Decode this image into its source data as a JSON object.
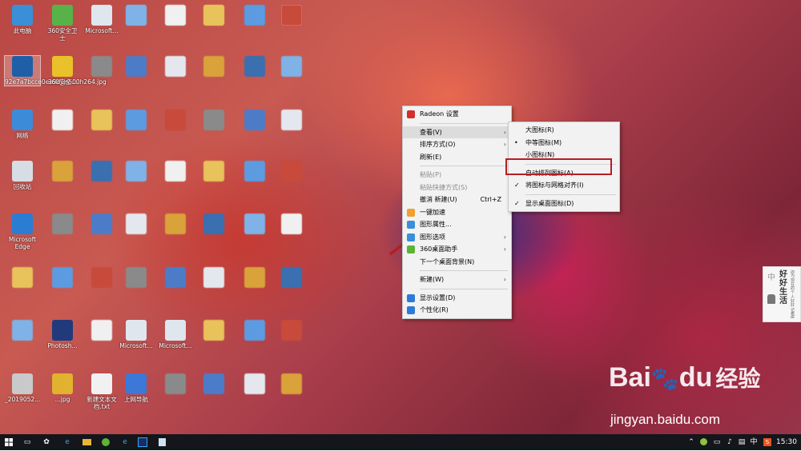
{
  "desktop_icons": [
    {
      "label": "此电脑",
      "color": "#3b8fd6"
    },
    {
      "label": "360安全卫士",
      "color": "#58b24a"
    },
    {
      "label": "Microsoft...",
      "color": "#dfe6ee"
    },
    {
      "label": "",
      "color": "#7a9abb"
    },
    {
      "label": "",
      "color": "#5a8fd8"
    },
    {
      "label": "",
      "color": "#e0a23c"
    },
    {
      "label": "",
      "color": "#6a6a6a"
    },
    {
      "label": "",
      "color": "#e7ecf4"
    },
    {
      "label": "92e7a7bcce0ee9d_w500h264.jpg",
      "color": "#1e5fa8"
    },
    {
      "label": "360安全...",
      "color": "#e9c12a"
    },
    {
      "label": "网络",
      "color": "#3c8bd9"
    },
    {
      "label": "回收站",
      "color": "#d7dde4"
    },
    {
      "label": "Microsoft Edge",
      "color": "#2b7cd3"
    },
    {
      "label": "Photosh...",
      "color": "#203a7c"
    },
    {
      "label": "Microsoft...",
      "color": "#dfe6ee"
    },
    {
      "label": "Microsoft...",
      "color": "#dfe6ee"
    },
    {
      "label": "新建文本文档.txt",
      "color": "#f1f1f1"
    },
    {
      "label": "上网导航",
      "color": "#3c78d8"
    },
    {
      "label": "_2019052...",
      "color": "#c9c9c9"
    },
    {
      "label": "...jpg",
      "color": "#e0b230"
    }
  ],
  "context_menu": {
    "items": [
      {
        "type": "item",
        "label": "Radeon 设置",
        "icon": "radeon-icon",
        "icon_color": "#d32f2f"
      },
      {
        "type": "sep"
      },
      {
        "type": "item",
        "label": "查看(V)",
        "submenu": true,
        "highlighted": true
      },
      {
        "type": "item",
        "label": "排序方式(O)",
        "submenu": true
      },
      {
        "type": "item",
        "label": "刷新(E)"
      },
      {
        "type": "sep"
      },
      {
        "type": "item",
        "label": "粘贴(P)",
        "disabled": true
      },
      {
        "type": "item",
        "label": "粘贴快捷方式(S)",
        "disabled": true
      },
      {
        "type": "item",
        "label": "撤消 新建(U)",
        "shortcut": "Ctrl+Z"
      },
      {
        "type": "item",
        "label": "一键加速",
        "icon": "speedup-icon",
        "icon_color": "#f0a030"
      },
      {
        "type": "item",
        "label": "图形属性...",
        "icon": "graphics-properties-icon",
        "icon_color": "#3a8fd8"
      },
      {
        "type": "item",
        "label": "图形选项",
        "icon": "graphics-options-icon",
        "icon_color": "#3a8fd8",
        "submenu": true
      },
      {
        "type": "item",
        "label": "360桌面助手",
        "icon": "360-desktop-icon",
        "icon_color": "#5cb335",
        "submenu": true
      },
      {
        "type": "item",
        "label": "下一个桌面背景(N)"
      },
      {
        "type": "sep"
      },
      {
        "type": "item",
        "label": "新建(W)",
        "submenu": true
      },
      {
        "type": "sep"
      },
      {
        "type": "item",
        "label": "显示设置(D)",
        "icon": "display-settings-icon",
        "icon_color": "#2f7ad6"
      },
      {
        "type": "item",
        "label": "个性化(R)",
        "icon": "personalize-icon",
        "icon_color": "#2f7ad6"
      }
    ]
  },
  "view_submenu": {
    "items": [
      {
        "type": "item",
        "label": "大图标(R)"
      },
      {
        "type": "item",
        "label": "中等图标(M)",
        "mark": "•"
      },
      {
        "type": "item",
        "label": "小图标(N)"
      },
      {
        "type": "sep"
      },
      {
        "type": "item",
        "label": "自动排列图标(A)",
        "boxed": true
      },
      {
        "type": "item",
        "label": "将图标与网格对齐(I)",
        "mark": "✓"
      },
      {
        "type": "sep"
      },
      {
        "type": "item",
        "label": "显示桌面图标(D)",
        "mark": "✓"
      }
    ]
  },
  "widget": {
    "title": "好好生活",
    "subtitle": "因为现在的个人好好记着呢",
    "top_char": "中"
  },
  "watermark": {
    "brand": "Bai",
    "paw": "🐾",
    "du": "du",
    "cn": "经验",
    "url": "jingyan.baidu.com"
  },
  "taskbar": {
    "time": "15:30",
    "ime": "中",
    "colors": {
      "bg": "#14161b",
      "accent": "#2f7ad6"
    }
  },
  "colors": {
    "annotation_red": "#b51d25"
  }
}
